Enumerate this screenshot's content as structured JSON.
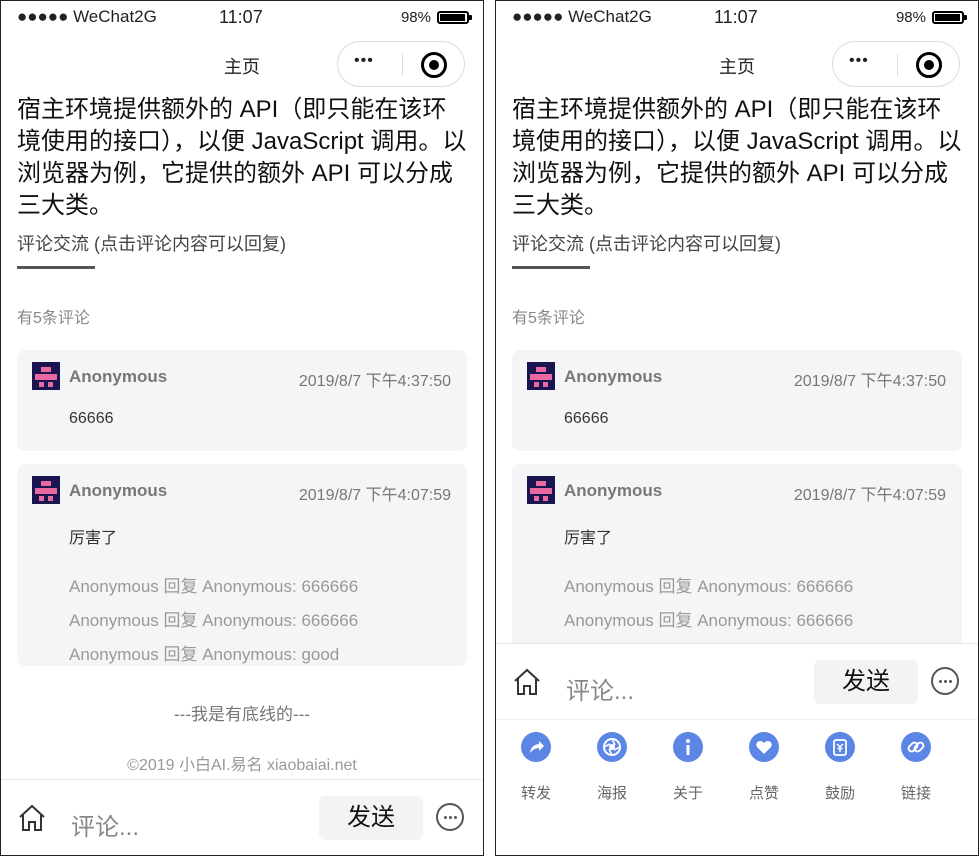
{
  "status_bar": {
    "signal": "●●●●● WeChat2G",
    "time": "11:07",
    "battery": "98%"
  },
  "nav": {
    "title": "主页",
    "menu_dots": "•••"
  },
  "article": {
    "text": "宿主环境提供额外的 API（即只能在该环境使用的接口），以便 JavaScript 调用。以浏览器为例，它提供的额外 API 可以分成三大类。"
  },
  "comments_section": {
    "title": "评论交流 (点击评论内容可以回复)",
    "count_text": "有5条评论",
    "comments": [
      {
        "author": "Anonymous",
        "time": "2019/8/7 下午4:37:50",
        "body": "66666",
        "replies": []
      },
      {
        "author": "Anonymous",
        "time": "2019/8/7 下午4:07:59",
        "body": "厉害了",
        "replies": [
          "Anonymous 回复 Anonymous: 666666",
          "Anonymous 回复 Anonymous: 666666",
          "Anonymous 回复 Anonymous: good"
        ]
      }
    ],
    "end_text": "---我是有底线的---",
    "copyright": "©2019 小白AI.易名 xiaobaiai.net"
  },
  "comment_bar": {
    "input_placeholder": "评论...",
    "send_label": "发送"
  },
  "action_bar": {
    "items": [
      {
        "label": "转发",
        "icon": "share-icon"
      },
      {
        "label": "海报",
        "icon": "aperture-icon"
      },
      {
        "label": "关于",
        "icon": "info-icon"
      },
      {
        "label": "点赞",
        "icon": "heart-icon"
      },
      {
        "label": "鼓励",
        "icon": "reward-icon"
      },
      {
        "label": "链接",
        "icon": "link-icon"
      }
    ]
  },
  "colors": {
    "action_blue": "#5b86e5",
    "avatar_pink": "#e96aa0",
    "avatar_navy": "#1a1450"
  }
}
